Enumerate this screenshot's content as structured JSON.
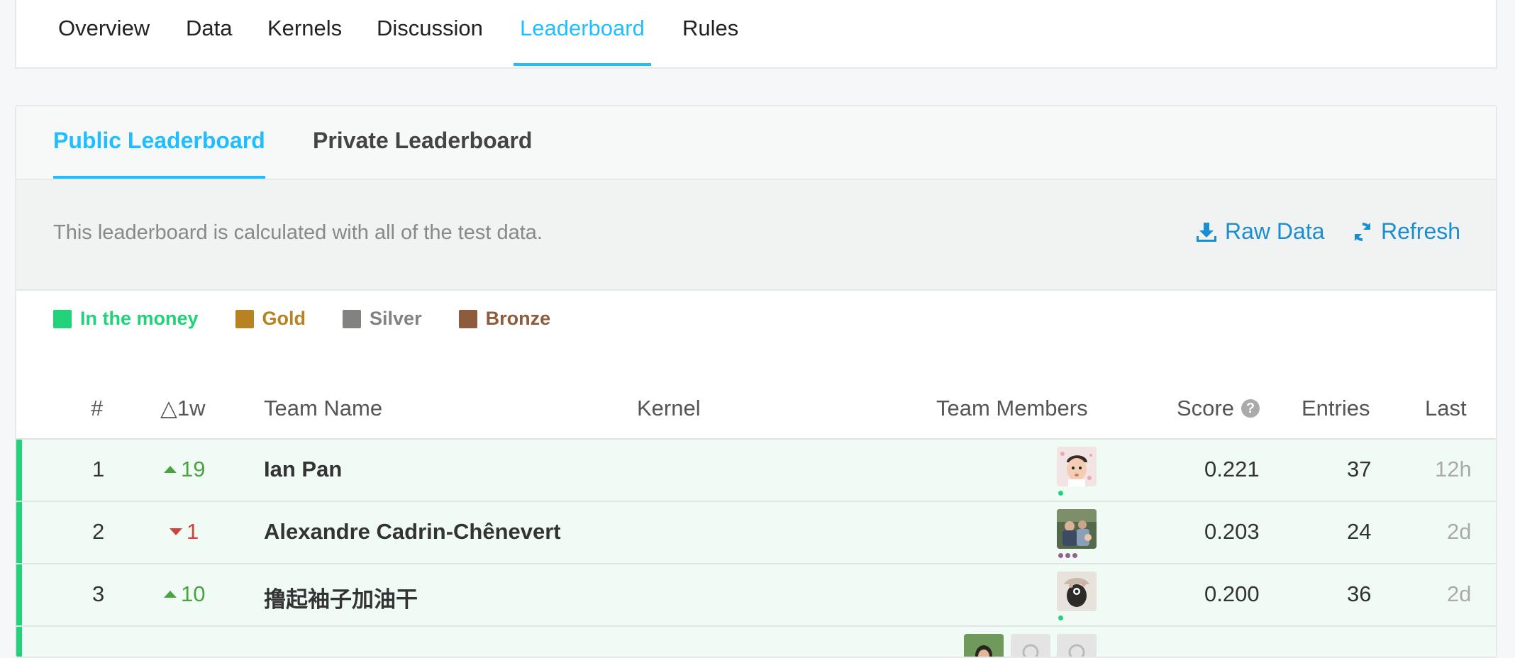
{
  "top_tabs": [
    {
      "label": "Overview"
    },
    {
      "label": "Data"
    },
    {
      "label": "Kernels"
    },
    {
      "label": "Discussion"
    },
    {
      "label": "Leaderboard"
    },
    {
      "label": "Rules"
    }
  ],
  "leaderboard_tabs": {
    "public": "Public Leaderboard",
    "private": "Private Leaderboard"
  },
  "info": {
    "text": "This leaderboard is calculated with all of the test data.",
    "raw_data": "Raw Data",
    "refresh": "Refresh"
  },
  "legend": {
    "money": "In the money",
    "gold": "Gold",
    "silver": "Silver",
    "bronze": "Bronze"
  },
  "colors": {
    "accent": "#20beff",
    "link": "#1a8ed2",
    "money": "#20d27a",
    "gold": "#b88121",
    "silver": "#838280",
    "bronze": "#8e5b3d",
    "up": "#4aa33f",
    "down": "#d2413a"
  },
  "table": {
    "headers": {
      "rank": "#",
      "change": "△1w",
      "team": "Team Name",
      "kernel": "Kernel",
      "members": "Team Members",
      "score": "Score",
      "entries": "Entries",
      "last": "Last"
    },
    "rows": [
      {
        "rank": "1",
        "change": "19",
        "direction": "up",
        "team": "Ian Pan",
        "score": "0.221",
        "entries": "37",
        "last": "12h"
      },
      {
        "rank": "2",
        "change": "1",
        "direction": "down",
        "team": "Alexandre Cadrin-Chênevert",
        "score": "0.203",
        "entries": "24",
        "last": "2d"
      },
      {
        "rank": "3",
        "change": "10",
        "direction": "up",
        "team": "撸起袖子加油干",
        "score": "0.200",
        "entries": "36",
        "last": "2d"
      }
    ]
  }
}
